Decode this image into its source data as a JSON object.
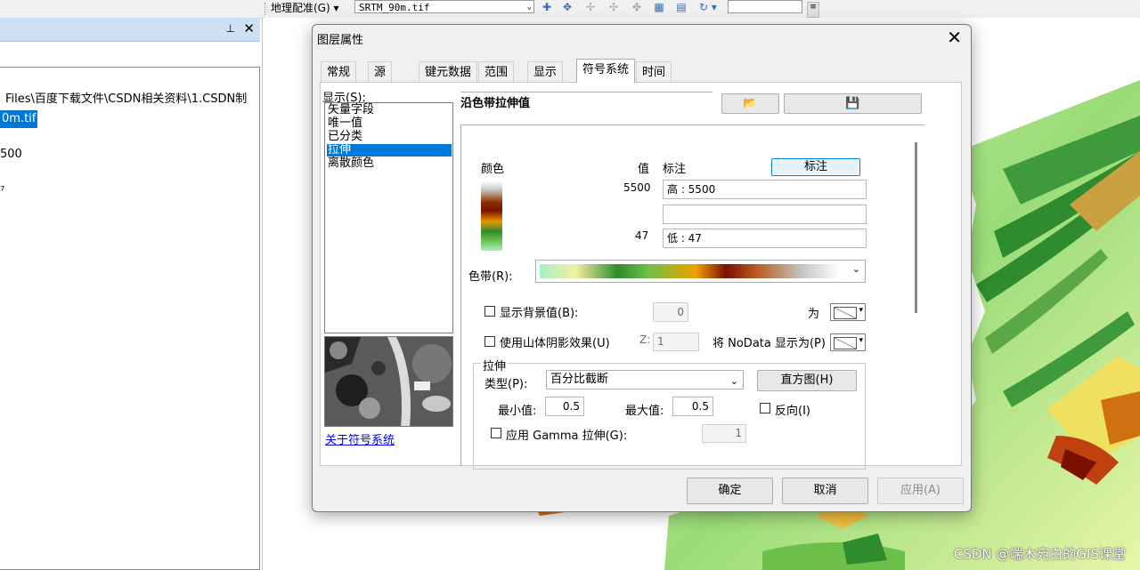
{
  "toolbar": {
    "georef_label": "地理配准(G) ▾",
    "layer_combo_value": "SRTM_90m.tif"
  },
  "toc": {
    "path_text": "Files\\百度下载文件\\CSDN相关资料\\1.CSDN制",
    "layer_name": "0m.tif",
    "value_text": "500",
    "caret_text": "⁷"
  },
  "dialog": {
    "title": "图层属性",
    "tabs": [
      "常规",
      "源",
      "键元数据",
      "范围",
      "显示",
      "符号系统",
      "时间"
    ],
    "active_tab": "符号系统",
    "show_label": "显示(S):",
    "show_items": [
      "矢量字段",
      "唯一值",
      "已分类",
      "拉伸",
      "离散颜色"
    ],
    "selected_show_item": "拉伸",
    "about_link": "关于符号系统",
    "heading": "沿色带拉伸值",
    "columns": {
      "color": "颜色",
      "value": "值",
      "label": "标注"
    },
    "label_button": "标注",
    "high_value": "5500",
    "low_value": "47",
    "high_label": "高 : 5500",
    "mid_label": "",
    "low_label": "低 : 47",
    "color_ramp_label": "色带(R):",
    "show_background_label": "显示背景值(B):",
    "background_value": "0",
    "as_label": "为",
    "hillshade_label": "使用山体阴影效果(U)",
    "z_label": "Z:",
    "z_value": "1",
    "nodata_label": "将 NoData 显示为(P)",
    "stretch_group_label": "拉伸",
    "type_label": "类型(P):",
    "type_value": "百分比截断",
    "histogram_button": "直方图(H)",
    "min_label": "最小值:",
    "min_value": "0.5",
    "max_label": "最大值:",
    "max_value": "0.5",
    "invert_label": "反向(I)",
    "gamma_label": "应用 Gamma 拉伸(G):",
    "gamma_value": "1",
    "ok_button": "确定",
    "cancel_button": "取消",
    "apply_button": "应用(A)"
  },
  "watermark": "CSDN @端木宛白的GIS课堂",
  "colors": {
    "selection": "#0078d7",
    "link": "#0000ee",
    "dem_low": "#a8f0c8",
    "dem_mid": "#2e8b2e",
    "dem_high": "#7a1000"
  },
  "icons": [
    "add-control-point-icon",
    "link-table-icon",
    "rotate-icon",
    "save-icon",
    "open-folder-icon",
    "pin-icon",
    "close-icon"
  ]
}
